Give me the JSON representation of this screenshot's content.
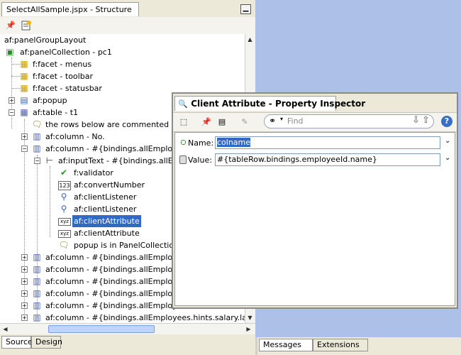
{
  "structure": {
    "tab_title": "SelectAllSample.jspx - Structure",
    "tree": [
      {
        "label": "af:panelGroupLayout"
      },
      {
        "label": "af:panelCollection - pc1"
      },
      {
        "label": "f:facet - menus"
      },
      {
        "label": "f:facet - toolbar"
      },
      {
        "label": "f:facet - statusbar"
      },
      {
        "label": "af:popup"
      },
      {
        "label": "af:table - t1"
      },
      {
        "label": "the rows below are commented out f"
      },
      {
        "label": "af:column - No."
      },
      {
        "label": "af:column - #{bindings.allEmployees"
      },
      {
        "label": "af:inputText - #{bindings.allEmp"
      },
      {
        "label": "f:validator"
      },
      {
        "label": "af:convertNumber"
      },
      {
        "label": "af:clientListener"
      },
      {
        "label": "af:clientListener"
      },
      {
        "label": "af:clientAttribute"
      },
      {
        "label": "af:clientAttribute"
      },
      {
        "label": "popup is in PanelCollection 'p"
      },
      {
        "label": "af:column - #{bindings.allEmployees"
      },
      {
        "label": "af:column - #{bindings.allEmployees"
      },
      {
        "label": "af:column - #{bindings.allEmployees"
      },
      {
        "label": "af:column - #{bindings.allEmployees"
      },
      {
        "label": "af:column - #{bindings.allEmployees"
      },
      {
        "label": "af:column - #{bindings.allEmployees.hints.salary.label}"
      }
    ],
    "bottom_tabs": [
      "Source",
      "Design"
    ]
  },
  "right_tabs": [
    "Messages",
    "Extensions"
  ],
  "inspector": {
    "title": "Client Attribute - Property Inspector",
    "find_placeholder": "Find",
    "help_glyph": "?",
    "name_label": "Name:",
    "name_value": "colname",
    "value_label": "Value:",
    "value_value": "#{tableRow.bindings.employeeId.name}"
  }
}
